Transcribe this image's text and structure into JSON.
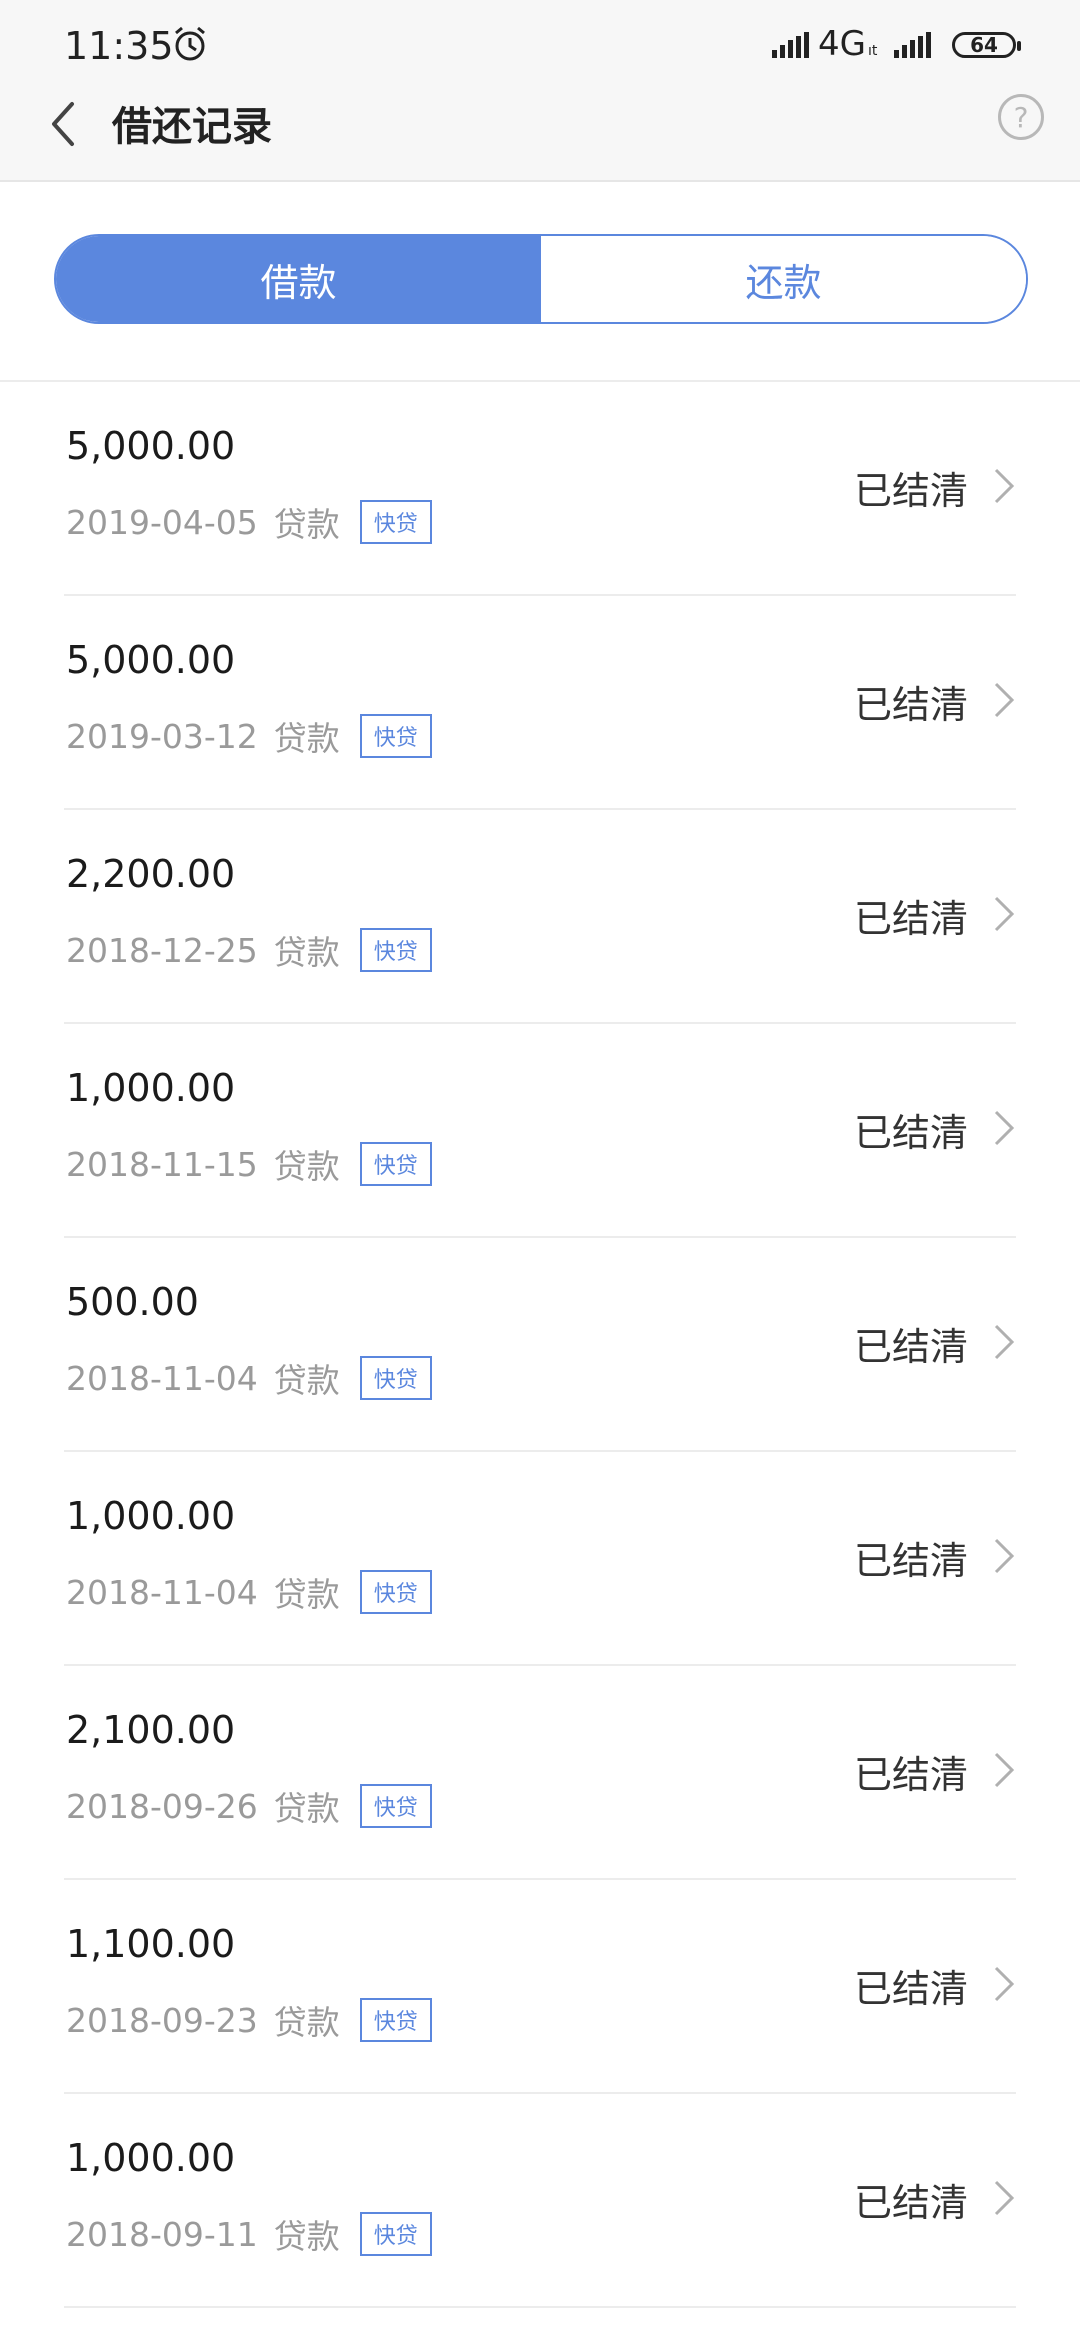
{
  "statusbar": {
    "time": "11:35",
    "network": "4G",
    "network_sub": "ıt",
    "battery": "64"
  },
  "navbar": {
    "title": "借还记录",
    "help": "?"
  },
  "tabs": [
    {
      "label": "借款",
      "active": true
    },
    {
      "label": "还款",
      "active": false
    }
  ],
  "records": [
    {
      "amount": "5,000.00",
      "date": "2019-04-05",
      "type": "贷款",
      "tag": "快贷",
      "status": "已结清"
    },
    {
      "amount": "5,000.00",
      "date": "2019-03-12",
      "type": "贷款",
      "tag": "快贷",
      "status": "已结清"
    },
    {
      "amount": "2,200.00",
      "date": "2018-12-25",
      "type": "贷款",
      "tag": "快贷",
      "status": "已结清"
    },
    {
      "amount": "1,000.00",
      "date": "2018-11-15",
      "type": "贷款",
      "tag": "快贷",
      "status": "已结清"
    },
    {
      "amount": "500.00",
      "date": "2018-11-04",
      "type": "贷款",
      "tag": "快贷",
      "status": "已结清"
    },
    {
      "amount": "1,000.00",
      "date": "2018-11-04",
      "type": "贷款",
      "tag": "快贷",
      "status": "已结清"
    },
    {
      "amount": "2,100.00",
      "date": "2018-09-26",
      "type": "贷款",
      "tag": "快贷",
      "status": "已结清"
    },
    {
      "amount": "1,100.00",
      "date": "2018-09-23",
      "type": "贷款",
      "tag": "快贷",
      "status": "已结清"
    },
    {
      "amount": "1,000.00",
      "date": "2018-09-11",
      "type": "贷款",
      "tag": "快贷",
      "status": "已结清"
    }
  ],
  "colors": {
    "accent": "#5b87de",
    "muted": "#9a9a9a"
  },
  "icons": {
    "back": "chevron-left-icon",
    "help": "question-circle-icon",
    "row_arrow": "chevron-right-icon",
    "alarm": "alarm-clock-icon"
  }
}
